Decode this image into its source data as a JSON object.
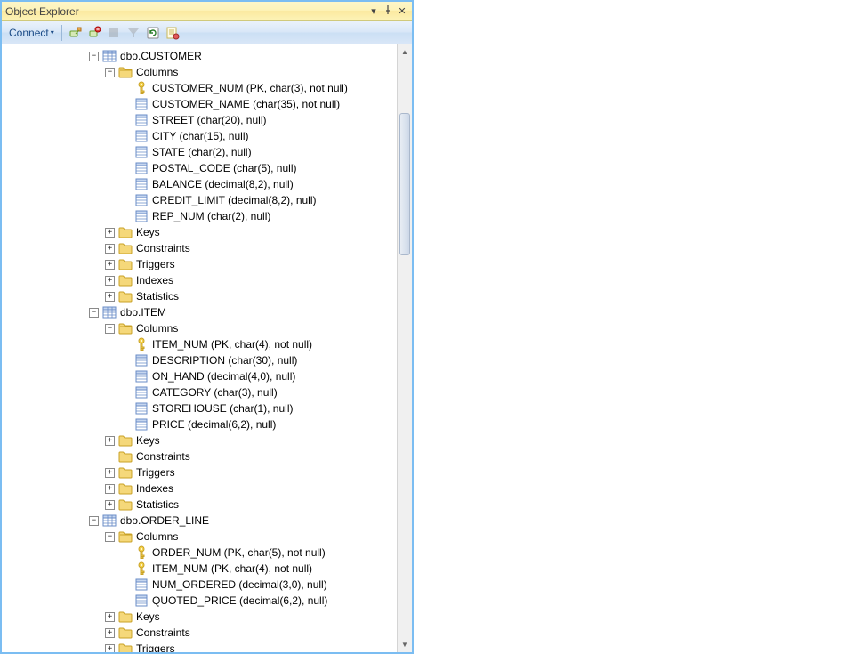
{
  "panel": {
    "title": "Object Explorer"
  },
  "toolbar": {
    "connect": "Connect"
  },
  "tree": {
    "tables": [
      {
        "name": "dbo.CUSTOMER",
        "columns_label": "Columns",
        "columns": [
          {
            "icon": "key",
            "label": "CUSTOMER_NUM (PK, char(3), not null)"
          },
          {
            "icon": "col",
            "label": "CUSTOMER_NAME (char(35), not null)"
          },
          {
            "icon": "col",
            "label": "STREET (char(20), null)"
          },
          {
            "icon": "col",
            "label": "CITY (char(15), null)"
          },
          {
            "icon": "col",
            "label": "STATE (char(2), null)"
          },
          {
            "icon": "col",
            "label": "POSTAL_CODE (char(5), null)"
          },
          {
            "icon": "col",
            "label": "BALANCE (decimal(8,2), null)"
          },
          {
            "icon": "col",
            "label": "CREDIT_LIMIT (decimal(8,2), null)"
          },
          {
            "icon": "col",
            "label": "REP_NUM (char(2), null)"
          }
        ],
        "folders": [
          {
            "label": "Keys",
            "exp": "plus"
          },
          {
            "label": "Constraints",
            "exp": "plus"
          },
          {
            "label": "Triggers",
            "exp": "plus"
          },
          {
            "label": "Indexes",
            "exp": "plus"
          },
          {
            "label": "Statistics",
            "exp": "plus"
          }
        ]
      },
      {
        "name": "dbo.ITEM",
        "columns_label": "Columns",
        "columns": [
          {
            "icon": "key",
            "label": "ITEM_NUM (PK, char(4), not null)"
          },
          {
            "icon": "col",
            "label": "DESCRIPTION (char(30), null)"
          },
          {
            "icon": "col",
            "label": "ON_HAND (decimal(4,0), null)"
          },
          {
            "icon": "col",
            "label": "CATEGORY (char(3), null)"
          },
          {
            "icon": "col",
            "label": "STOREHOUSE (char(1), null)"
          },
          {
            "icon": "col",
            "label": "PRICE (decimal(6,2), null)"
          }
        ],
        "folders": [
          {
            "label": "Keys",
            "exp": "plus"
          },
          {
            "label": "Constraints",
            "exp": "none"
          },
          {
            "label": "Triggers",
            "exp": "plus"
          },
          {
            "label": "Indexes",
            "exp": "plus"
          },
          {
            "label": "Statistics",
            "exp": "plus"
          }
        ]
      },
      {
        "name": "dbo.ORDER_LINE",
        "columns_label": "Columns",
        "columns": [
          {
            "icon": "key",
            "label": "ORDER_NUM (PK, char(5), not null)"
          },
          {
            "icon": "key",
            "label": "ITEM_NUM (PK, char(4), not null)"
          },
          {
            "icon": "col",
            "label": "NUM_ORDERED (decimal(3,0), null)"
          },
          {
            "icon": "col",
            "label": "QUOTED_PRICE (decimal(6,2), null)"
          }
        ],
        "folders": [
          {
            "label": "Keys",
            "exp": "plus"
          },
          {
            "label": "Constraints",
            "exp": "plus"
          },
          {
            "label": "Triggers",
            "exp": "plus"
          }
        ]
      }
    ]
  }
}
